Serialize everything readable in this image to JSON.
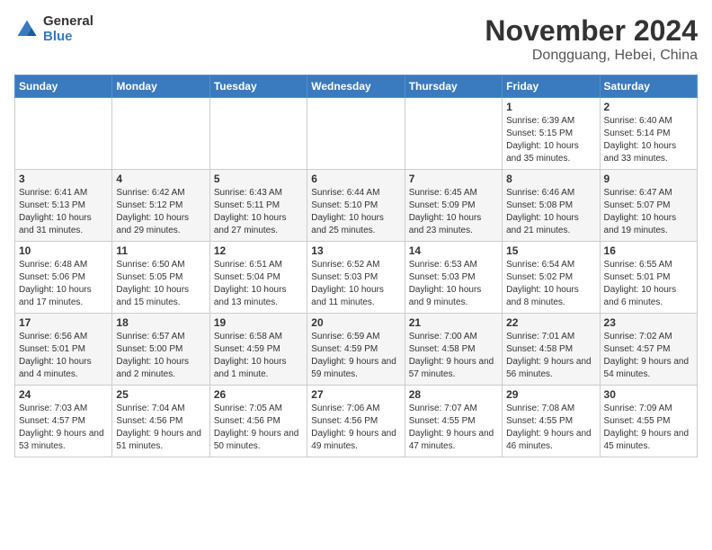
{
  "header": {
    "logo_general": "General",
    "logo_blue": "Blue",
    "month_title": "November 2024",
    "location": "Dongguang, Hebei, China"
  },
  "weekdays": [
    "Sunday",
    "Monday",
    "Tuesday",
    "Wednesday",
    "Thursday",
    "Friday",
    "Saturday"
  ],
  "weeks": [
    [
      {
        "day": "",
        "info": ""
      },
      {
        "day": "",
        "info": ""
      },
      {
        "day": "",
        "info": ""
      },
      {
        "day": "",
        "info": ""
      },
      {
        "day": "",
        "info": ""
      },
      {
        "day": "1",
        "info": "Sunrise: 6:39 AM\nSunset: 5:15 PM\nDaylight: 10 hours and 35 minutes."
      },
      {
        "day": "2",
        "info": "Sunrise: 6:40 AM\nSunset: 5:14 PM\nDaylight: 10 hours and 33 minutes."
      }
    ],
    [
      {
        "day": "3",
        "info": "Sunrise: 6:41 AM\nSunset: 5:13 PM\nDaylight: 10 hours and 31 minutes."
      },
      {
        "day": "4",
        "info": "Sunrise: 6:42 AM\nSunset: 5:12 PM\nDaylight: 10 hours and 29 minutes."
      },
      {
        "day": "5",
        "info": "Sunrise: 6:43 AM\nSunset: 5:11 PM\nDaylight: 10 hours and 27 minutes."
      },
      {
        "day": "6",
        "info": "Sunrise: 6:44 AM\nSunset: 5:10 PM\nDaylight: 10 hours and 25 minutes."
      },
      {
        "day": "7",
        "info": "Sunrise: 6:45 AM\nSunset: 5:09 PM\nDaylight: 10 hours and 23 minutes."
      },
      {
        "day": "8",
        "info": "Sunrise: 6:46 AM\nSunset: 5:08 PM\nDaylight: 10 hours and 21 minutes."
      },
      {
        "day": "9",
        "info": "Sunrise: 6:47 AM\nSunset: 5:07 PM\nDaylight: 10 hours and 19 minutes."
      }
    ],
    [
      {
        "day": "10",
        "info": "Sunrise: 6:48 AM\nSunset: 5:06 PM\nDaylight: 10 hours and 17 minutes."
      },
      {
        "day": "11",
        "info": "Sunrise: 6:50 AM\nSunset: 5:05 PM\nDaylight: 10 hours and 15 minutes."
      },
      {
        "day": "12",
        "info": "Sunrise: 6:51 AM\nSunset: 5:04 PM\nDaylight: 10 hours and 13 minutes."
      },
      {
        "day": "13",
        "info": "Sunrise: 6:52 AM\nSunset: 5:03 PM\nDaylight: 10 hours and 11 minutes."
      },
      {
        "day": "14",
        "info": "Sunrise: 6:53 AM\nSunset: 5:03 PM\nDaylight: 10 hours and 9 minutes."
      },
      {
        "day": "15",
        "info": "Sunrise: 6:54 AM\nSunset: 5:02 PM\nDaylight: 10 hours and 8 minutes."
      },
      {
        "day": "16",
        "info": "Sunrise: 6:55 AM\nSunset: 5:01 PM\nDaylight: 10 hours and 6 minutes."
      }
    ],
    [
      {
        "day": "17",
        "info": "Sunrise: 6:56 AM\nSunset: 5:01 PM\nDaylight: 10 hours and 4 minutes."
      },
      {
        "day": "18",
        "info": "Sunrise: 6:57 AM\nSunset: 5:00 PM\nDaylight: 10 hours and 2 minutes."
      },
      {
        "day": "19",
        "info": "Sunrise: 6:58 AM\nSunset: 4:59 PM\nDaylight: 10 hours and 1 minute."
      },
      {
        "day": "20",
        "info": "Sunrise: 6:59 AM\nSunset: 4:59 PM\nDaylight: 9 hours and 59 minutes."
      },
      {
        "day": "21",
        "info": "Sunrise: 7:00 AM\nSunset: 4:58 PM\nDaylight: 9 hours and 57 minutes."
      },
      {
        "day": "22",
        "info": "Sunrise: 7:01 AM\nSunset: 4:58 PM\nDaylight: 9 hours and 56 minutes."
      },
      {
        "day": "23",
        "info": "Sunrise: 7:02 AM\nSunset: 4:57 PM\nDaylight: 9 hours and 54 minutes."
      }
    ],
    [
      {
        "day": "24",
        "info": "Sunrise: 7:03 AM\nSunset: 4:57 PM\nDaylight: 9 hours and 53 minutes."
      },
      {
        "day": "25",
        "info": "Sunrise: 7:04 AM\nSunset: 4:56 PM\nDaylight: 9 hours and 51 minutes."
      },
      {
        "day": "26",
        "info": "Sunrise: 7:05 AM\nSunset: 4:56 PM\nDaylight: 9 hours and 50 minutes."
      },
      {
        "day": "27",
        "info": "Sunrise: 7:06 AM\nSunset: 4:56 PM\nDaylight: 9 hours and 49 minutes."
      },
      {
        "day": "28",
        "info": "Sunrise: 7:07 AM\nSunset: 4:55 PM\nDaylight: 9 hours and 47 minutes."
      },
      {
        "day": "29",
        "info": "Sunrise: 7:08 AM\nSunset: 4:55 PM\nDaylight: 9 hours and 46 minutes."
      },
      {
        "day": "30",
        "info": "Sunrise: 7:09 AM\nSunset: 4:55 PM\nDaylight: 9 hours and 45 minutes."
      }
    ]
  ]
}
